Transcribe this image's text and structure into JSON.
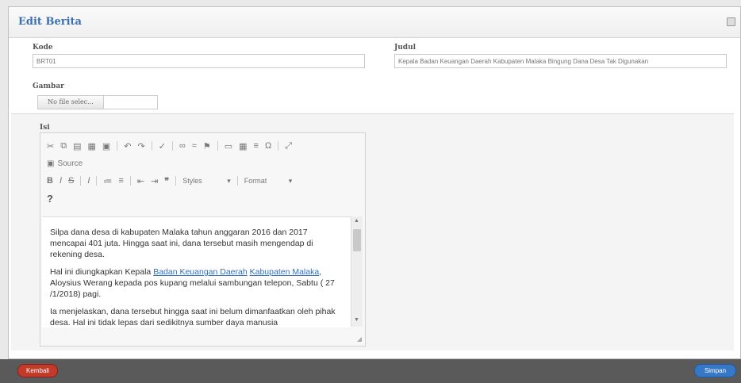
{
  "window": {
    "title": "Edit Berita"
  },
  "form": {
    "kode": {
      "label": "Kode",
      "value": "BRT01"
    },
    "judul": {
      "label": "Judul",
      "value": "Kepala Badan Keuangan Daerah Kabupaten Malaka Bingung Dana Desa Tak Digunakan"
    },
    "gambar": {
      "label": "Gambar",
      "file_button": "No file selec..."
    },
    "isi": {
      "label": "Isi"
    }
  },
  "editor": {
    "source_label": "Source",
    "styles_label": "Styles",
    "format_label": "Format",
    "help_label": "?",
    "content": {
      "p1": "Silpa dana desa di kabupaten Malaka tahun anggaran 2016 dan 2017 mencapai 401 juta. Hingga saat ini, dana tersebut masih mengendap di rekening desa.",
      "p2_prefix": "Hal ini diungkapkan Kepala",
      "p2_link1": "Badan Keuangan Daerah",
      "p2_link2": "Kabupaten Malaka",
      "p2_suffix": ", Aloysius Werang kepada pos kupang melalui sambungan telepon, Sabtu ( 27 /1/2018) pagi.",
      "p3": "Ia menjelaskan, dana tersebut hingga saat ini belum dimanfaatkan oleh pihak desa. Hal ini tidak lepas dari sedikitnya sumber daya manusia"
    }
  },
  "footer": {
    "back": "Kembali",
    "save": "Simpan"
  }
}
